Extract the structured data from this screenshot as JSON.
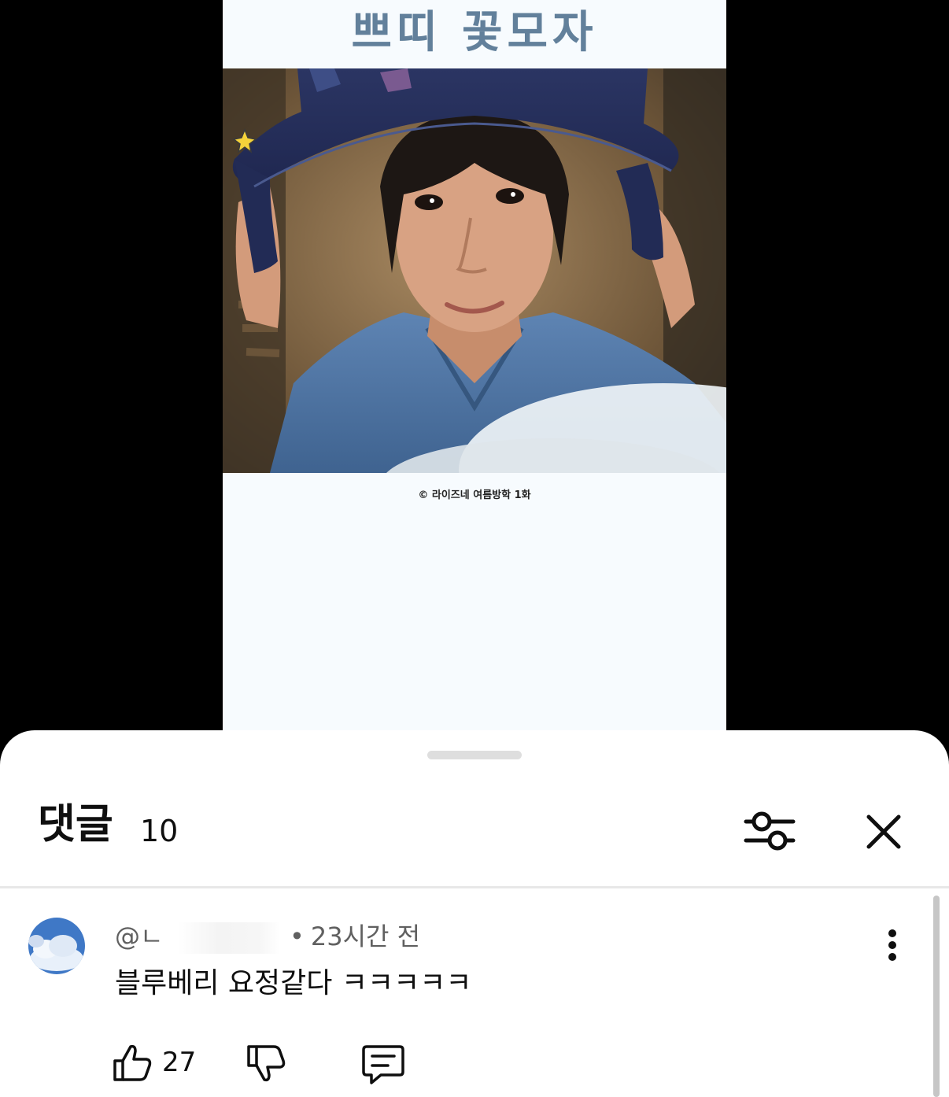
{
  "video": {
    "title": "쁘띠 꽃모자",
    "caption": "© 라이즈네 여름방학 1화",
    "overlay_text": "~~"
  },
  "comments_sheet": {
    "title": "댓글",
    "count": "10",
    "filter_icon": "sliders-icon",
    "close_icon": "close-icon"
  },
  "comment": {
    "author_handle": "@ㄴ",
    "separator": "•",
    "timestamp": "23시간 전",
    "text": "블루베리 요정같다 ㅋㅋㅋㅋㅋ",
    "like_count": "27",
    "icons": {
      "like": "thumbs-up-icon",
      "dislike": "thumbs-down-icon",
      "reply": "reply-comment-icon",
      "more": "more-vertical-icon"
    }
  },
  "colors": {
    "title_color": "#62809b",
    "sheet_bg": "#ffffff",
    "text_primary": "#0f0f0f",
    "text_secondary": "#606060"
  }
}
